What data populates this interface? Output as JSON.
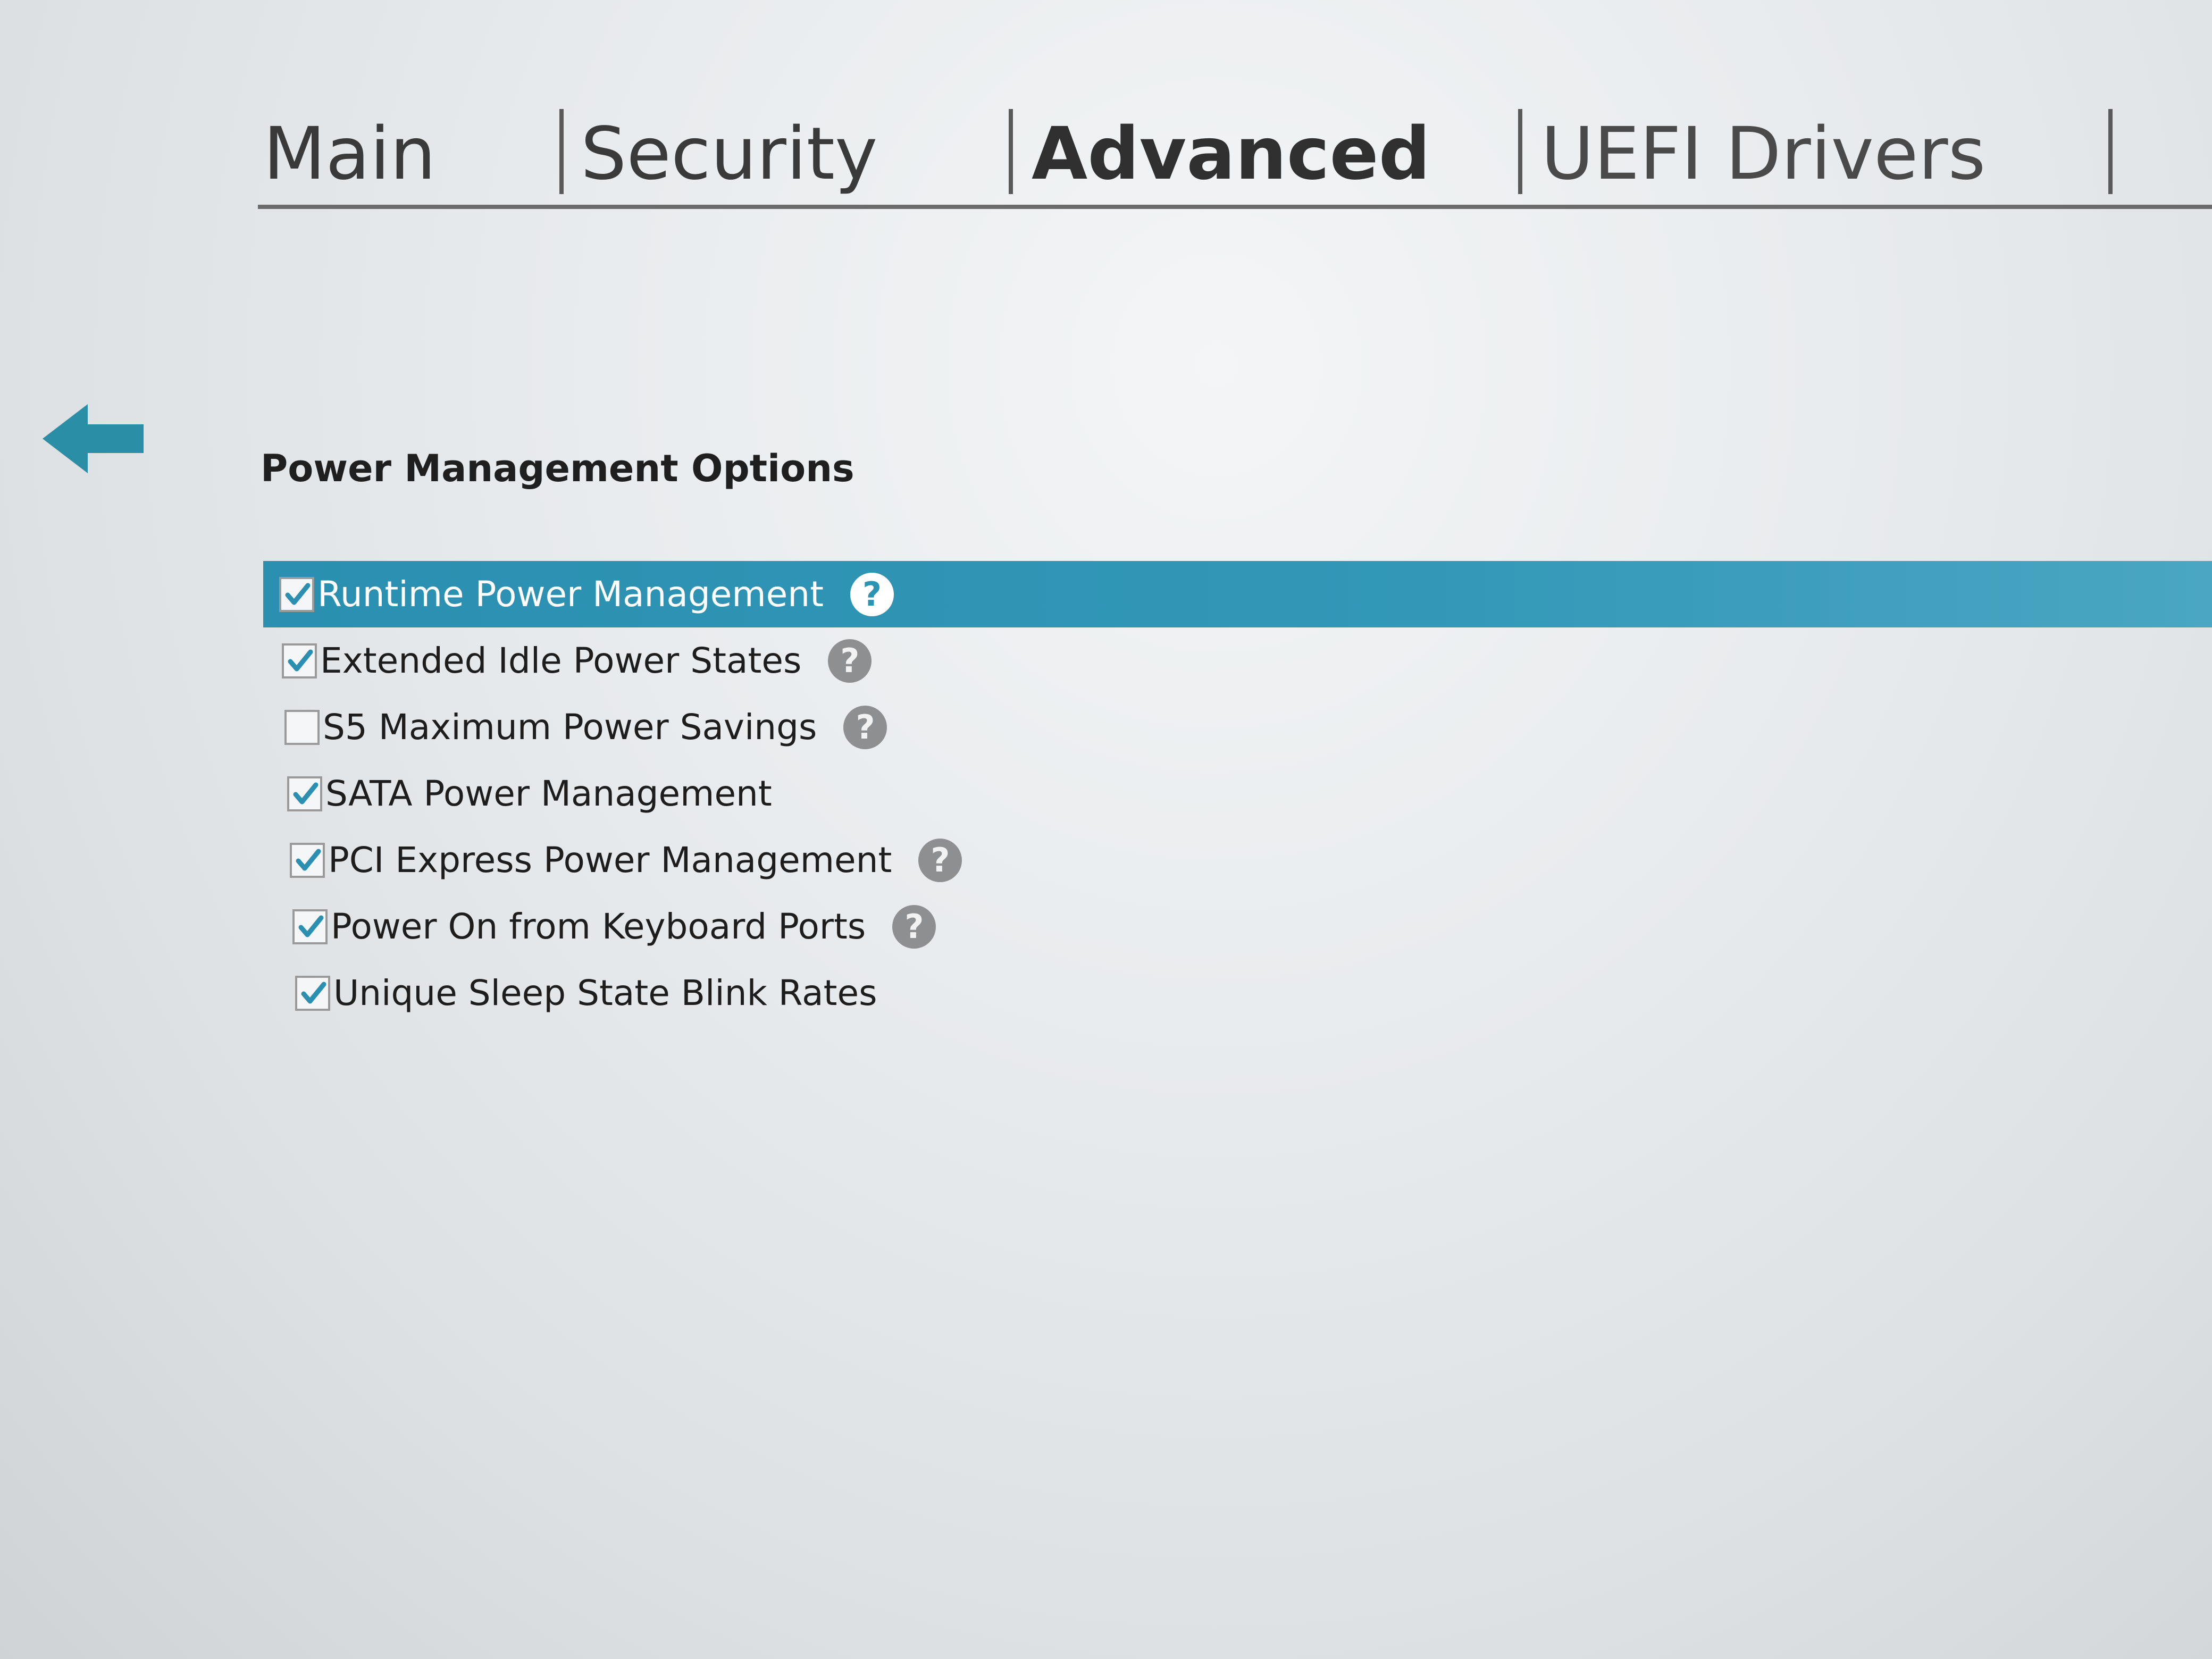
{
  "tabs": [
    {
      "label": "Main",
      "active": false
    },
    {
      "label": "Security",
      "active": false
    },
    {
      "label": "Advanced",
      "active": true
    },
    {
      "label": "UEFI Drivers",
      "active": false
    }
  ],
  "back_icon": "arrow-left-icon",
  "section": {
    "title": "Power Management Options"
  },
  "options": [
    {
      "label": "Runtime Power Management",
      "checked": true,
      "has_help": true,
      "selected": true
    },
    {
      "label": "Extended Idle Power States",
      "checked": true,
      "has_help": true,
      "selected": false
    },
    {
      "label": "S5 Maximum Power Savings",
      "checked": false,
      "has_help": true,
      "selected": false
    },
    {
      "label": "SATA Power Management",
      "checked": true,
      "has_help": false,
      "selected": false
    },
    {
      "label": "PCI Express Power Management",
      "checked": true,
      "has_help": true,
      "selected": false
    },
    {
      "label": "Power On from Keyboard Ports",
      "checked": true,
      "has_help": true,
      "selected": false
    },
    {
      "label": "Unique Sleep State Blink Rates",
      "checked": true,
      "has_help": false,
      "selected": false
    }
  ],
  "help_glyph": "?",
  "colors": {
    "accent": "#2a8fb0",
    "check": "#2a8fb0",
    "help_bg": "#8d8f90"
  }
}
